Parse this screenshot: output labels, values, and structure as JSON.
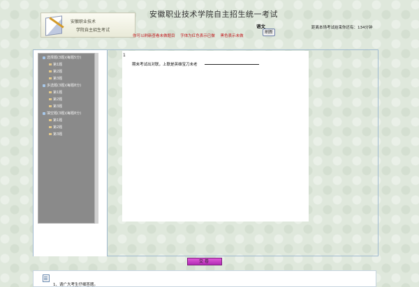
{
  "header": {
    "logo_line1": "安徽职业技术",
    "logo_line2": "学院自主招生考试",
    "title": "安徽职业技术学院自主招生统一考试",
    "hint": "你可以刷新查看未做题目  字体为红色表示已做  黑色表示未做",
    "subject": "语文",
    "refresh_label": "刷新",
    "timer_text": "距离本场考试结束你还有：134分钟"
  },
  "tree": {
    "sections": [
      {
        "label": "选择题(3题)(每题5分)",
        "items": [
          "第1题",
          "第2题",
          "第3题"
        ]
      },
      {
        "label": "多选题(3题)(每题8分)",
        "items": [
          "第1题",
          "第2题",
          "第3题"
        ]
      },
      {
        "label": "填空题(3题)(每题8分)",
        "items": [
          "第1题",
          "第2题",
          "第3题"
        ]
      }
    ]
  },
  "question": {
    "number": "1",
    "text": "期末考试出对联，上联是英雄宝刀未老"
  },
  "submit_label": "交卷",
  "notice": {
    "text": "1、请广大考生仔细答题。"
  },
  "colors": {
    "hint": "#c2181c",
    "tree_bg": "#8a8a8a",
    "frame_border": "#9fb9cf",
    "submit": "#c63cc8"
  }
}
